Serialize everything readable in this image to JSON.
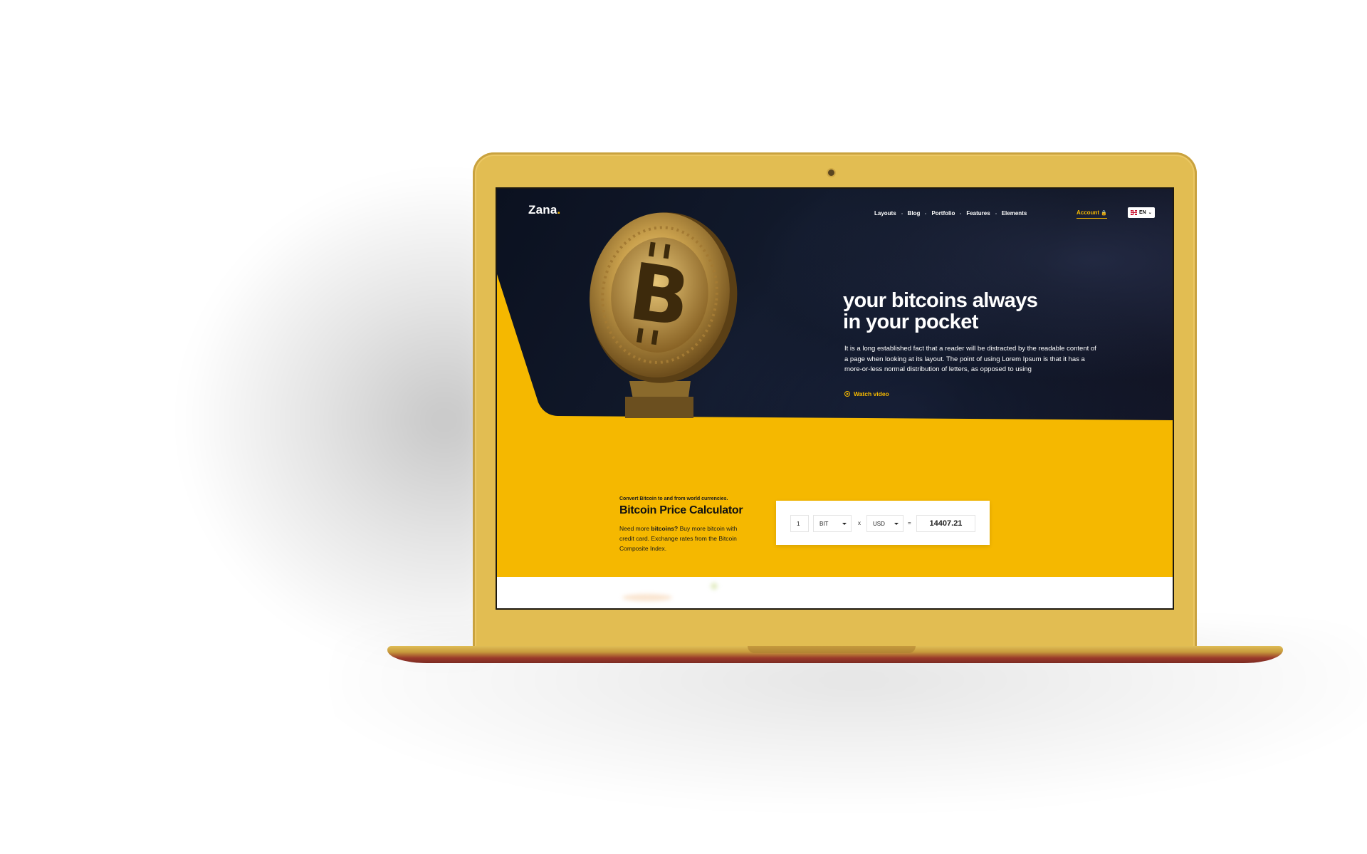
{
  "site": {
    "logo": "Zana",
    "logo_dot": ".",
    "nav": [
      "Layouts",
      "Blog",
      "Portfolio",
      "Features",
      "Elements"
    ],
    "account_label": "Account",
    "language": "EN"
  },
  "hero": {
    "title_line1": "your bitcoins always",
    "title_line2": "in your pocket",
    "text": "It is a long established fact that a reader will be distracted by the readable content of a page when looking at its layout. The point of using Lorem Ipsum is that it has a more-or-less normal distribution of letters, as opposed to using",
    "watch_label": "Watch video"
  },
  "calculator": {
    "subtitle": "Convert Bitcoin to and from world currencies.",
    "title": "Bitcoin Price Calculator",
    "desc_prefix": "Need more ",
    "desc_bold": "bitcoins?",
    "desc_suffix": " Buy more bitcoin with credit card. Exchange rates from the Bitcoin Composite Index.",
    "amount": "1",
    "from_currency": "BIT",
    "times": "x",
    "to_currency": "USD",
    "equals": "=",
    "result": "14407.21"
  },
  "colors": {
    "accent": "#f5b800",
    "hero_bg": "#0b1120",
    "laptop_gold": "#e2bd52"
  }
}
